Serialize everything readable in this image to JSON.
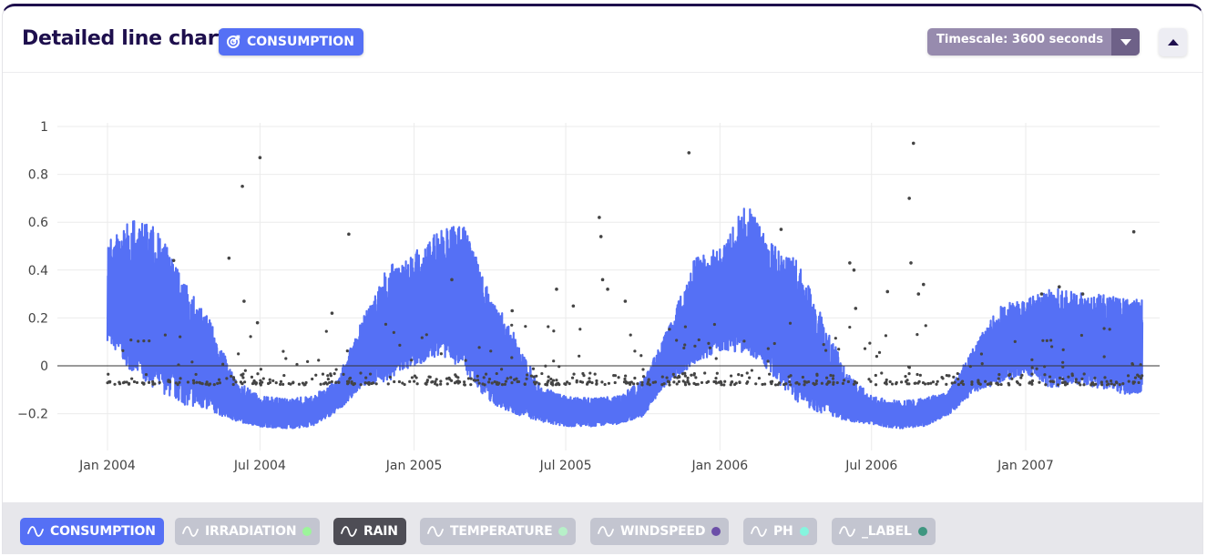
{
  "header": {
    "title": "Detailed line chart",
    "badge_label": "CONSUMPTION",
    "badge_icon": "target-icon",
    "timescale_label": "Timescale: 3600 seconds",
    "timescale_caret_icon": "caret-down-icon",
    "collapse_icon": "caret-up-icon"
  },
  "colors": {
    "title": "#1e0f4d",
    "accent": "#5570f5",
    "timescale_bg": "#978bae",
    "timescale_caret_bg": "#6e6188",
    "consumption": "#5570f5",
    "rain": "#444444",
    "chip_inactive": "#c3c5d0",
    "chip_rain": "#4e4d55"
  },
  "legend": [
    {
      "label": "CONSUMPTION",
      "state": "active",
      "dot": null,
      "bg": "#5570f5"
    },
    {
      "label": "IRRADIATION",
      "state": "inactive",
      "dot": "#9cf59a",
      "bg": "#c3c5d0"
    },
    {
      "label": "RAIN",
      "state": "active",
      "dot": null,
      "bg": "#4e4d55"
    },
    {
      "label": "TEMPERATURE",
      "state": "inactive",
      "dot": "#b7f0c8",
      "bg": "#c3c5d0"
    },
    {
      "label": "WINDSPEED",
      "state": "inactive",
      "dot": "#6b4fa8",
      "bg": "#c3c5d0"
    },
    {
      "label": "PH",
      "state": "inactive",
      "dot": "#86f5de",
      "bg": "#c3c5d0"
    },
    {
      "label": "_LABEL",
      "state": "inactive",
      "dot": "#3f9680",
      "bg": "#c3c5d0"
    }
  ],
  "chart_data": {
    "type": "line",
    "title": "Detailed line chart",
    "xlabel": "",
    "ylabel": "",
    "x_type": "date",
    "xlim": [
      "2004-01-01",
      "2007-05-20"
    ],
    "ylim": [
      -0.28,
      1.05
    ],
    "grid": true,
    "legend_position": "bottom",
    "x_ticks": [
      "Jan 2004",
      "Jul 2004",
      "Jan 2005",
      "Jul 2005",
      "Jan 2006",
      "Jul 2006",
      "Jan 2007"
    ],
    "y_ticks": [
      -0.2,
      0,
      0.2,
      0.4,
      0.6,
      0.8,
      1
    ],
    "y_tick_labels": [
      "−0.2",
      "0",
      "0.2",
      "0.4",
      "0.6",
      "0.8",
      "1"
    ],
    "series": [
      {
        "name": "CONSUMPTION",
        "mode": "lines (dense hourly, shown as monthly min/max envelope)",
        "months": [
          "2004-01",
          "2004-02",
          "2004-03",
          "2004-04",
          "2004-05",
          "2004-06",
          "2004-07",
          "2004-08",
          "2004-09",
          "2004-10",
          "2004-11",
          "2004-12",
          "2005-01",
          "2005-02",
          "2005-03",
          "2005-04",
          "2005-05",
          "2005-06",
          "2005-07",
          "2005-08",
          "2005-09",
          "2005-10",
          "2005-11",
          "2005-12",
          "2006-01",
          "2006-02",
          "2006-03",
          "2006-04",
          "2006-05",
          "2006-06",
          "2006-07",
          "2006-08",
          "2006-09",
          "2006-10",
          "2006-11",
          "2006-12",
          "2007-01",
          "2007-02",
          "2007-03",
          "2007-04",
          "2007-05"
        ],
        "max": [
          0.55,
          0.65,
          0.61,
          0.38,
          0.22,
          -0.05,
          -0.12,
          -0.13,
          -0.12,
          -0.05,
          0.22,
          0.45,
          0.5,
          0.6,
          0.63,
          0.33,
          0.15,
          -0.08,
          -0.12,
          -0.13,
          -0.12,
          -0.05,
          0.18,
          0.47,
          0.52,
          0.72,
          0.55,
          0.48,
          0.25,
          -0.02,
          -0.12,
          -0.14,
          -0.13,
          -0.1,
          0.1,
          0.27,
          0.3,
          0.35,
          0.34,
          0.32,
          0.3
        ],
        "min": [
          0.08,
          -0.07,
          -0.14,
          -0.19,
          -0.21,
          -0.24,
          -0.26,
          -0.27,
          -0.26,
          -0.2,
          -0.1,
          -0.09,
          -0.03,
          0.02,
          -0.05,
          -0.18,
          -0.22,
          -0.24,
          -0.26,
          -0.26,
          -0.25,
          -0.22,
          -0.08,
          -0.02,
          0.04,
          0.02,
          -0.06,
          -0.18,
          -0.22,
          -0.24,
          -0.25,
          -0.27,
          -0.26,
          -0.21,
          -0.12,
          -0.09,
          -0.05,
          -0.12,
          -0.1,
          -0.12,
          -0.14
        ]
      },
      {
        "name": "RAIN",
        "mode": "markers",
        "baseline_band": [
          -0.08,
          -0.03
        ],
        "notable_points": [
          {
            "x": "2004-03-20",
            "y": 0.44
          },
          {
            "x": "2004-05-25",
            "y": 0.45
          },
          {
            "x": "2004-06-10",
            "y": 0.75
          },
          {
            "x": "2004-06-12",
            "y": 0.27
          },
          {
            "x": "2004-06-28",
            "y": 0.18
          },
          {
            "x": "2004-07-01",
            "y": 0.87
          },
          {
            "x": "2004-10-15",
            "y": 0.55
          },
          {
            "x": "2004-09-25",
            "y": 0.22
          },
          {
            "x": "2005-02-15",
            "y": 0.36
          },
          {
            "x": "2005-04-28",
            "y": 0.23
          },
          {
            "x": "2005-06-20",
            "y": 0.32
          },
          {
            "x": "2005-07-10",
            "y": 0.25
          },
          {
            "x": "2005-08-10",
            "y": 0.62
          },
          {
            "x": "2005-08-12",
            "y": 0.54
          },
          {
            "x": "2005-08-14",
            "y": 0.36
          },
          {
            "x": "2005-08-20",
            "y": 0.32
          },
          {
            "x": "2005-09-10",
            "y": 0.27
          },
          {
            "x": "2005-11-25",
            "y": 0.89
          },
          {
            "x": "2006-03-15",
            "y": 0.57
          },
          {
            "x": "2006-06-05",
            "y": 0.43
          },
          {
            "x": "2006-06-10",
            "y": 0.4
          },
          {
            "x": "2006-06-12",
            "y": 0.24
          },
          {
            "x": "2006-07-20",
            "y": 0.31
          },
          {
            "x": "2006-08-15",
            "y": 0.7
          },
          {
            "x": "2006-08-20",
            "y": 0.93
          },
          {
            "x": "2006-08-17",
            "y": 0.43
          },
          {
            "x": "2006-08-26",
            "y": 0.3
          },
          {
            "x": "2006-09-01",
            "y": 0.34
          },
          {
            "x": "2007-01-20",
            "y": 0.3
          },
          {
            "x": "2007-02-10",
            "y": 0.33
          },
          {
            "x": "2007-03-10",
            "y": 0.3
          },
          {
            "x": "2007-05-10",
            "y": 0.56
          }
        ]
      }
    ]
  }
}
